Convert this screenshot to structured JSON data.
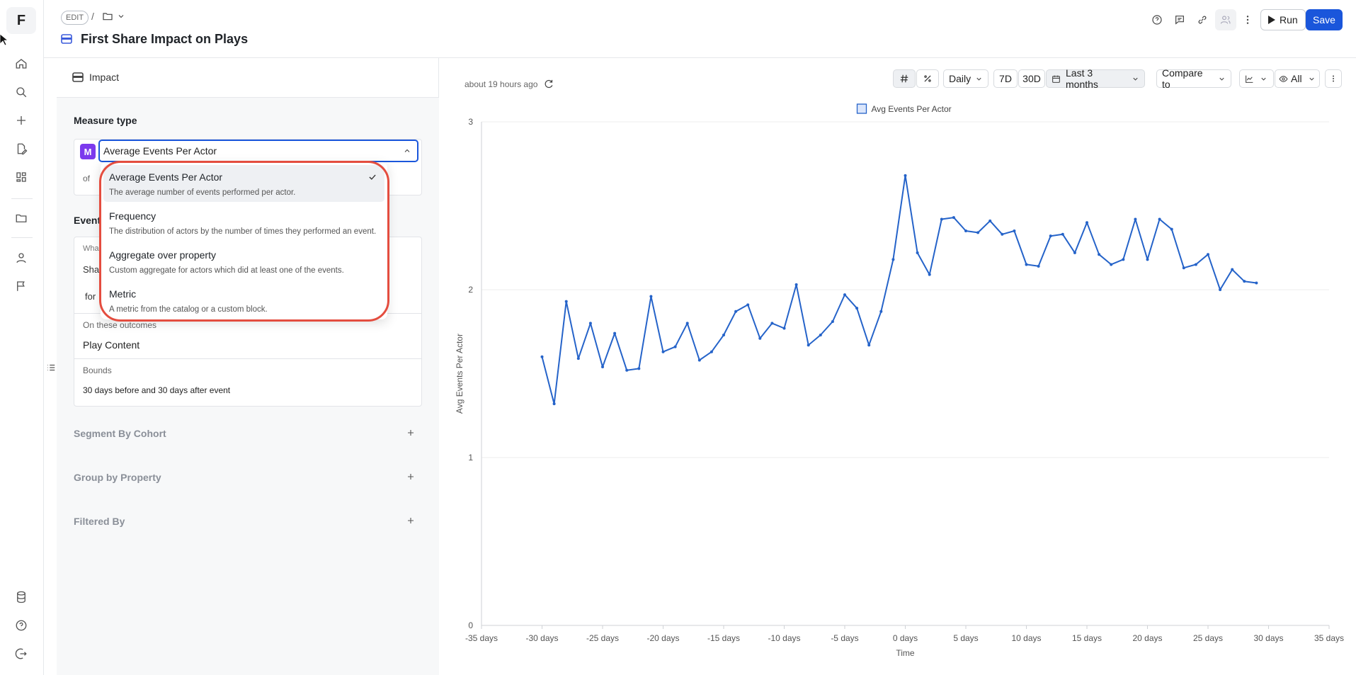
{
  "app": {
    "logo": "F"
  },
  "header": {
    "edit_badge": "EDIT",
    "breadcrumb_sep": "/",
    "title": "First Share Impact on Plays",
    "run_label": "Run",
    "save_label": "Save"
  },
  "panel": {
    "tab_label": "Impact",
    "measure_type_label": "Measure type",
    "measure_badge": "M",
    "measure_selected": "Average Events Per Actor",
    "of_prefix": "of",
    "events_label_frag": "Event",
    "what_frag": "Wha",
    "share_frag": "Sha",
    "for_frag": "for",
    "outcomes_label": "On these outcomes",
    "outcomes_value": "Play Content",
    "bounds_label": "Bounds",
    "bounds_value": "30 days before and 30 days after event",
    "segment_label": "Segment By Cohort",
    "group_label": "Group by Property",
    "filter_label": "Filtered By"
  },
  "dropdown": {
    "options": [
      {
        "title": "Average Events Per Actor",
        "desc": "The average number of events performed per actor.",
        "selected": true
      },
      {
        "title": "Frequency",
        "desc": "The distribution of actors by the number of times they performed an event.",
        "selected": false
      },
      {
        "title": "Aggregate over property",
        "desc": "Custom aggregate for actors which did at least one of the events.",
        "selected": false
      },
      {
        "title": "Metric",
        "desc": "A metric from the catalog or a custom block.",
        "selected": false
      }
    ]
  },
  "toolbar": {
    "updated": "about 19 hours ago",
    "interval": "Daily",
    "range_7d": "7D",
    "range_30d": "30D",
    "range_label": "Last 3 months",
    "compare_label": "Compare to",
    "visibility_label": "All"
  },
  "colors": {
    "accent": "#1a56db",
    "line": "#2563c9",
    "highlight": "#e44d3f",
    "badge": "#7c3aed"
  },
  "chart_data": {
    "type": "line",
    "title": "",
    "xlabel": "Time",
    "ylabel": "Avg Events Per Actor",
    "legend": "Avg Events Per Actor",
    "legend_position": "top-center",
    "grid": true,
    "xlim": [
      -35,
      35
    ],
    "ylim": [
      0,
      3
    ],
    "x_ticks": [
      -35,
      -30,
      -25,
      -20,
      -15,
      -10,
      -5,
      0,
      5,
      10,
      15,
      20,
      25,
      30,
      35
    ],
    "x_tick_labels": [
      "-35 days",
      "-30 days",
      "-25 days",
      "-20 days",
      "-15 days",
      "-10 days",
      "-5 days",
      "0 days",
      "5 days",
      "10 days",
      "15 days",
      "20 days",
      "25 days",
      "30 days",
      "35 days"
    ],
    "y_ticks": [
      0,
      1,
      2,
      3
    ],
    "series": [
      {
        "name": "Avg Events Per Actor",
        "x": [
          -30,
          -29,
          -28,
          -27,
          -26,
          -25,
          -24,
          -23,
          -22,
          -21,
          -20,
          -19,
          -18,
          -17,
          -16,
          -15,
          -14,
          -13,
          -12,
          -11,
          -10,
          -9,
          -8,
          -7,
          -6,
          -5,
          -4,
          -3,
          -2,
          -1,
          0,
          1,
          2,
          3,
          4,
          5,
          6,
          7,
          8,
          9,
          10,
          11,
          12,
          13,
          14,
          15,
          16,
          17,
          18,
          19,
          20,
          21,
          22,
          23,
          24,
          25,
          26,
          27,
          28,
          29
        ],
        "values": [
          1.6,
          1.32,
          1.93,
          1.59,
          1.8,
          1.54,
          1.74,
          1.52,
          1.53,
          1.96,
          1.63,
          1.66,
          1.8,
          1.58,
          1.63,
          1.73,
          1.87,
          1.91,
          1.71,
          1.8,
          1.77,
          2.03,
          1.67,
          1.73,
          1.81,
          1.97,
          1.89,
          1.67,
          1.87,
          2.18,
          2.68,
          2.22,
          2.09,
          2.42,
          2.43,
          2.35,
          2.34,
          2.41,
          2.33,
          2.35,
          2.15,
          2.14,
          2.32,
          2.33,
          2.22,
          2.4,
          2.21,
          2.15,
          2.18,
          2.42,
          2.18,
          2.42,
          2.36,
          2.13,
          2.15,
          2.21,
          2.0,
          2.12,
          2.05,
          2.04
        ]
      }
    ]
  }
}
